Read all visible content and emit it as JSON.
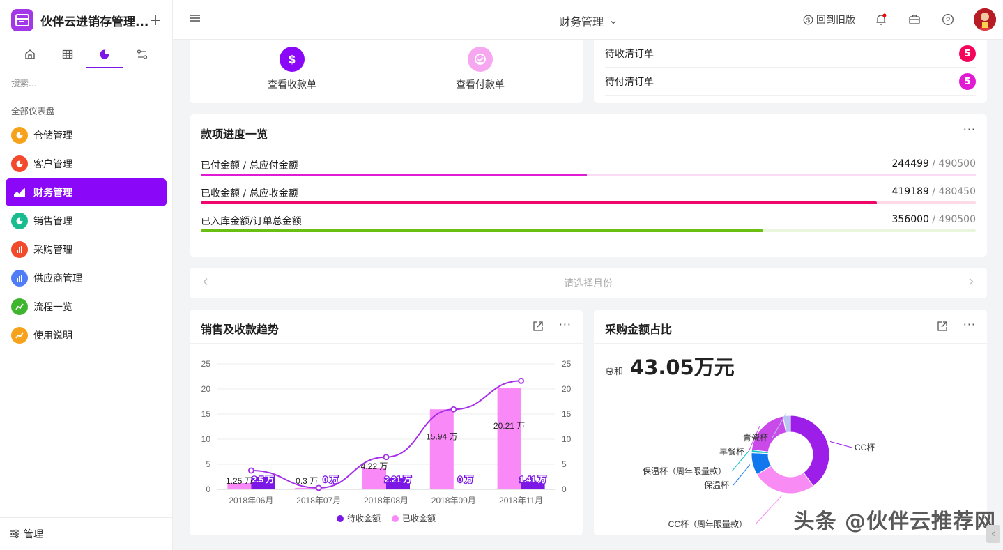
{
  "app": {
    "name": "伙伴云进销存管理...",
    "plus": "+"
  },
  "sidebar": {
    "search_placeholder": "搜索...",
    "section_title": "全部仪表盘",
    "items": [
      {
        "label": "仓储管理",
        "color": "#f7a21b"
      },
      {
        "label": "客户管理",
        "color": "#f24a2c"
      },
      {
        "label": "财务管理",
        "color": "#8a07f7"
      },
      {
        "label": "销售管理",
        "color": "#19bc8e"
      },
      {
        "label": "采购管理",
        "color": "#f24a2c"
      },
      {
        "label": "供应商管理",
        "color": "#4f7cf7"
      },
      {
        "label": "流程一览",
        "color": "#3fb52f"
      },
      {
        "label": "使用说明",
        "color": "#f7a21b"
      }
    ],
    "footer_label": "管理"
  },
  "topbar": {
    "title": "财务管理",
    "old_version": "回到旧版"
  },
  "quick_actions": {
    "receipt": "查看收款单",
    "payment": "查看付款单"
  },
  "todos": [
    {
      "label": "待收清订单",
      "count": "5",
      "color": "#f5045b"
    },
    {
      "label": "待付清订单",
      "count": "5",
      "color": "#e11ad4"
    }
  ],
  "progress_card": {
    "title": "款项进度一览",
    "rows": [
      {
        "label": "已付金额 / 总应付金额",
        "value": "244499",
        "total": "/ 490500",
        "pct": 0.4985,
        "color": "#e11ad4",
        "track": "#fbdcf7"
      },
      {
        "label": "已收金额 / 总应收金额",
        "value": "419189",
        "total": "/ 480450",
        "pct": 0.8725,
        "color": "#f0066a",
        "track": "#fcdbe7"
      },
      {
        "label": "已入库金额/订单总金额",
        "value": "356000",
        "total": "/ 490500",
        "pct": 0.7258,
        "color": "#6bbe12",
        "track": "#e9f5dc"
      }
    ]
  },
  "month_picker": {
    "placeholder": "请选择月份"
  },
  "sales_card": {
    "title": "销售及收款趋势"
  },
  "purchase_card": {
    "title": "采购金额占比",
    "total_label": "总和",
    "total_value": "43.05万元"
  },
  "chart_data": [
    {
      "type": "bar",
      "title": "销售及收款趋势",
      "categories": [
        "2018年06月",
        "2018年07月",
        "2018年08月",
        "2018年09月",
        "2018年11月"
      ],
      "ylim": [
        0,
        25
      ],
      "yticks": [
        0,
        5,
        10,
        15,
        20,
        25
      ],
      "series": [
        {
          "name": "待收金额",
          "type": "bar",
          "color": "#7c18e6",
          "values": [
            2.5,
            0,
            2.21,
            0,
            1.41
          ],
          "labels": [
            "2.5 万",
            "0 万",
            "2.21 万",
            "0 万",
            "1.41 万"
          ]
        },
        {
          "name": "已收金额",
          "type": "bar",
          "color": "#f989f7",
          "values": [
            1.25,
            0.3,
            4.22,
            15.94,
            20.21
          ],
          "labels": [
            "1.25 万",
            "0.3 万",
            "4.22 万",
            "15.94 万",
            "20.21 万"
          ]
        },
        {
          "name": "",
          "type": "line",
          "color": "#a52ee8",
          "values": [
            3.75,
            0.3,
            6.43,
            15.94,
            21.62
          ]
        }
      ],
      "legend_position": "bottom"
    },
    {
      "type": "pie",
      "title": "采购金额占比",
      "slices": [
        {
          "label": "CC杯",
          "value": 0.4,
          "color": "#9c1ee8"
        },
        {
          "label": "CC杯（周年限量款）",
          "value": 0.265,
          "color": "#f98bf5"
        },
        {
          "label": "保温杯",
          "value": 0.092,
          "color": "#1177ee"
        },
        {
          "label": "保温杯（周年限量款）",
          "value": 0.012,
          "color": "#14c2c8"
        },
        {
          "label": "早餐杯",
          "value": 0.2,
          "color": "#c94ae8"
        },
        {
          "label": "青瓷杯",
          "value": 0.031,
          "color": "#b9c6ef"
        }
      ]
    }
  ],
  "watermark": "头条 @伙伴云推荐网"
}
